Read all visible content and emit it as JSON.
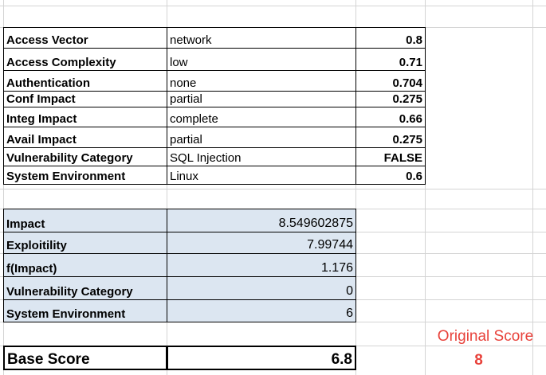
{
  "params": [
    {
      "label": "Access Vector",
      "value": "network",
      "num": "0.8"
    },
    {
      "label": "Access Complexity",
      "value": "low",
      "num": "0.71"
    },
    {
      "label": "Authentication",
      "value": "none",
      "num": "0.704"
    },
    {
      "label": "Conf Impact",
      "value": "partial",
      "num": "0.275"
    },
    {
      "label": "Integ Impact",
      "value": "complete",
      "num": "0.66"
    },
    {
      "label": "Avail Impact",
      "value": "partial",
      "num": "0.275"
    },
    {
      "label": "Vulnerability Category",
      "value": "SQL Injection",
      "num": "FALSE"
    },
    {
      "label": "System Environment",
      "value": "Linux",
      "num": "0.6"
    }
  ],
  "results": [
    {
      "label": "Impact",
      "value": "8.549602875"
    },
    {
      "label": "Exploitility",
      "value": "7.99744"
    },
    {
      "label": "f(Impact)",
      "value": "1.176"
    },
    {
      "label": "Vulnerability Category",
      "value": "0"
    },
    {
      "label": "System Environment",
      "value": "6"
    }
  ],
  "original_score": {
    "label": "Original Score",
    "value": "8"
  },
  "base_score": {
    "label": "Base Score",
    "value": "6.8"
  },
  "colors": {
    "grid": "#d4d4d4",
    "result_fill": "#dce6f1",
    "original_score": "#e8423b"
  }
}
